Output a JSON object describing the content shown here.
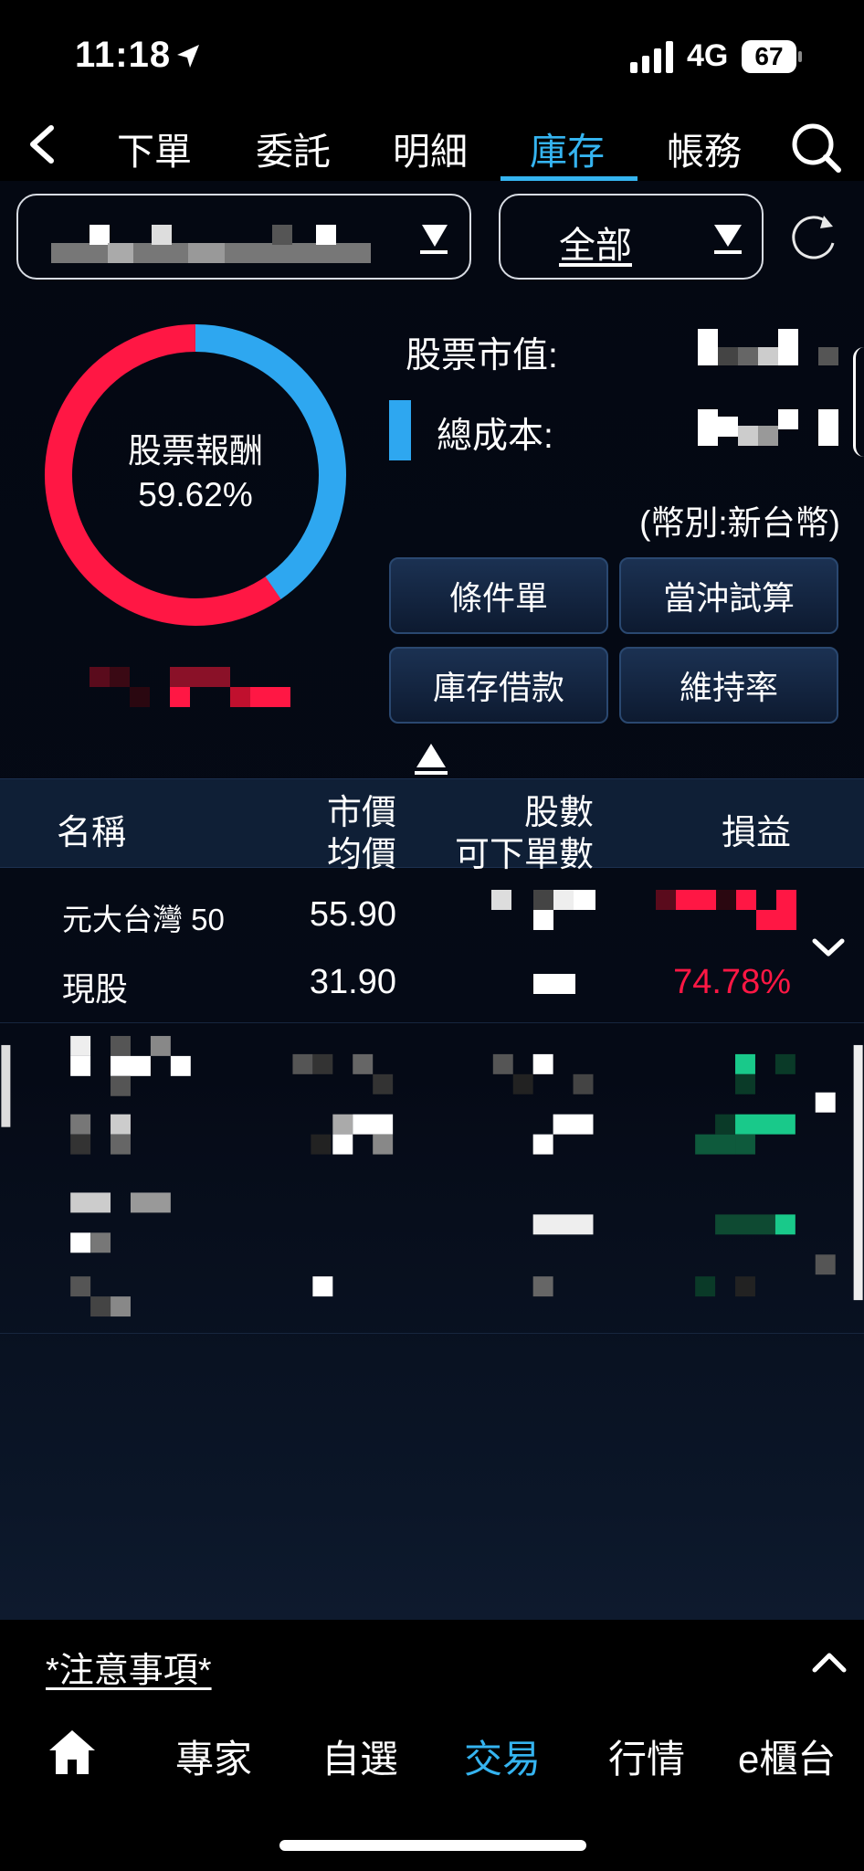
{
  "status_bar": {
    "time": "11:18",
    "network": "4G",
    "battery": "67"
  },
  "tabs": [
    {
      "label": "下單",
      "active": false
    },
    {
      "label": "委託",
      "active": false
    },
    {
      "label": "明細",
      "active": false
    },
    {
      "label": "庫存",
      "active": true
    },
    {
      "label": "帳務",
      "active": false
    }
  ],
  "filter": {
    "selected": "全部"
  },
  "donut": {
    "label": "股票報酬",
    "value": "59.62%",
    "return_fraction": 0.5962,
    "colors": {
      "return": "#ff1744",
      "cost": "#2ea7f0"
    }
  },
  "summary": {
    "market_value_label": "股票市值:",
    "total_cost_label": "總成本:",
    "currency_note": "(幣別:新台幣)"
  },
  "buttons": {
    "conditional_order": "條件單",
    "day_trade_calc": "當沖試算",
    "inventory_loan": "庫存借款",
    "maintenance_rate": "維持率"
  },
  "table": {
    "headers": {
      "name": "名稱",
      "price": "市價",
      "avg_price": "均價",
      "shares": "股數",
      "orderable": "可下單數",
      "pnl": "損益"
    },
    "rows": [
      {
        "name": "元大台灣 50",
        "type": "現股",
        "price": "55.90",
        "avg_price": "31.90",
        "pnl_pct": "74.78%"
      }
    ]
  },
  "notice": "*注意事項*",
  "bottom_nav": [
    {
      "label": "專家",
      "active": false
    },
    {
      "label": "自選",
      "active": false
    },
    {
      "label": "交易",
      "active": true
    },
    {
      "label": "行情",
      "active": false
    },
    {
      "label": "e櫃台",
      "active": false
    }
  ],
  "colors": {
    "accent": "#35b4f0",
    "loss": "#ff1744",
    "gain": "#19c98a"
  }
}
